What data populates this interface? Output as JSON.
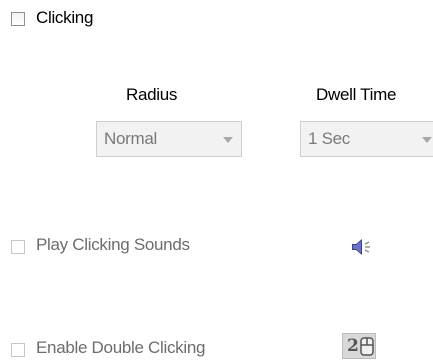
{
  "clicking": {
    "label": "Clicking",
    "checked": false
  },
  "radius": {
    "header": "Radius",
    "selected": "Normal"
  },
  "dwell_time": {
    "header": "Dwell Time",
    "selected": "1 Sec"
  },
  "play_sounds": {
    "label": "Play Clicking Sounds",
    "checked": false,
    "icon": "speaker-icon"
  },
  "double_click": {
    "label": "Enable Double Clicking",
    "checked": false,
    "icon": "double-click-icon",
    "icon_text": "2"
  }
}
